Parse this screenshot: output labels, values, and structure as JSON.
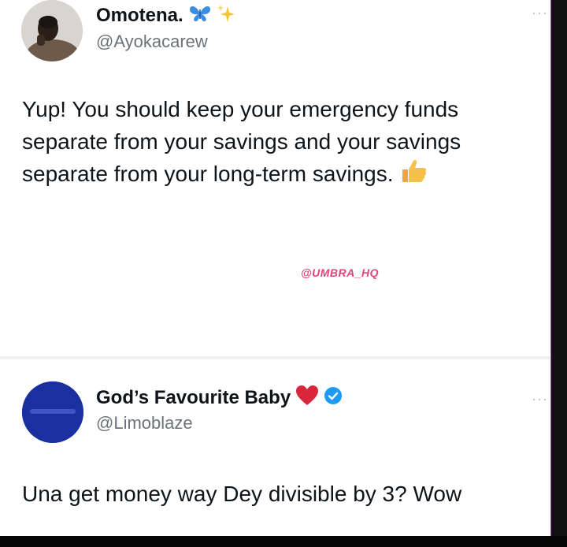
{
  "tweet1": {
    "name": "Omotena.",
    "handle": "@Ayokacarew",
    "text": "Yup! You should keep your emergency funds separate from your savings and your savings separate from your long-term savings.",
    "name_icons": [
      "butterfly-icon",
      "sparkles-icon"
    ],
    "text_icon": "thumbs-up-icon"
  },
  "watermark": "@UMBRA_HQ",
  "tweet2": {
    "name": "God’s Favourite Baby",
    "handle": "@Limoblaze",
    "text": "Una get money way Dey divisible by 3? Wow",
    "name_icons": [
      "red-heart-icon",
      "verified-badge-icon"
    ]
  },
  "more_label": "···",
  "colors": {
    "text": "#0f1419",
    "handle": "#6b737a",
    "watermark": "#e0457a",
    "verified": "#1d9bf0",
    "heart": "#d9263b"
  }
}
